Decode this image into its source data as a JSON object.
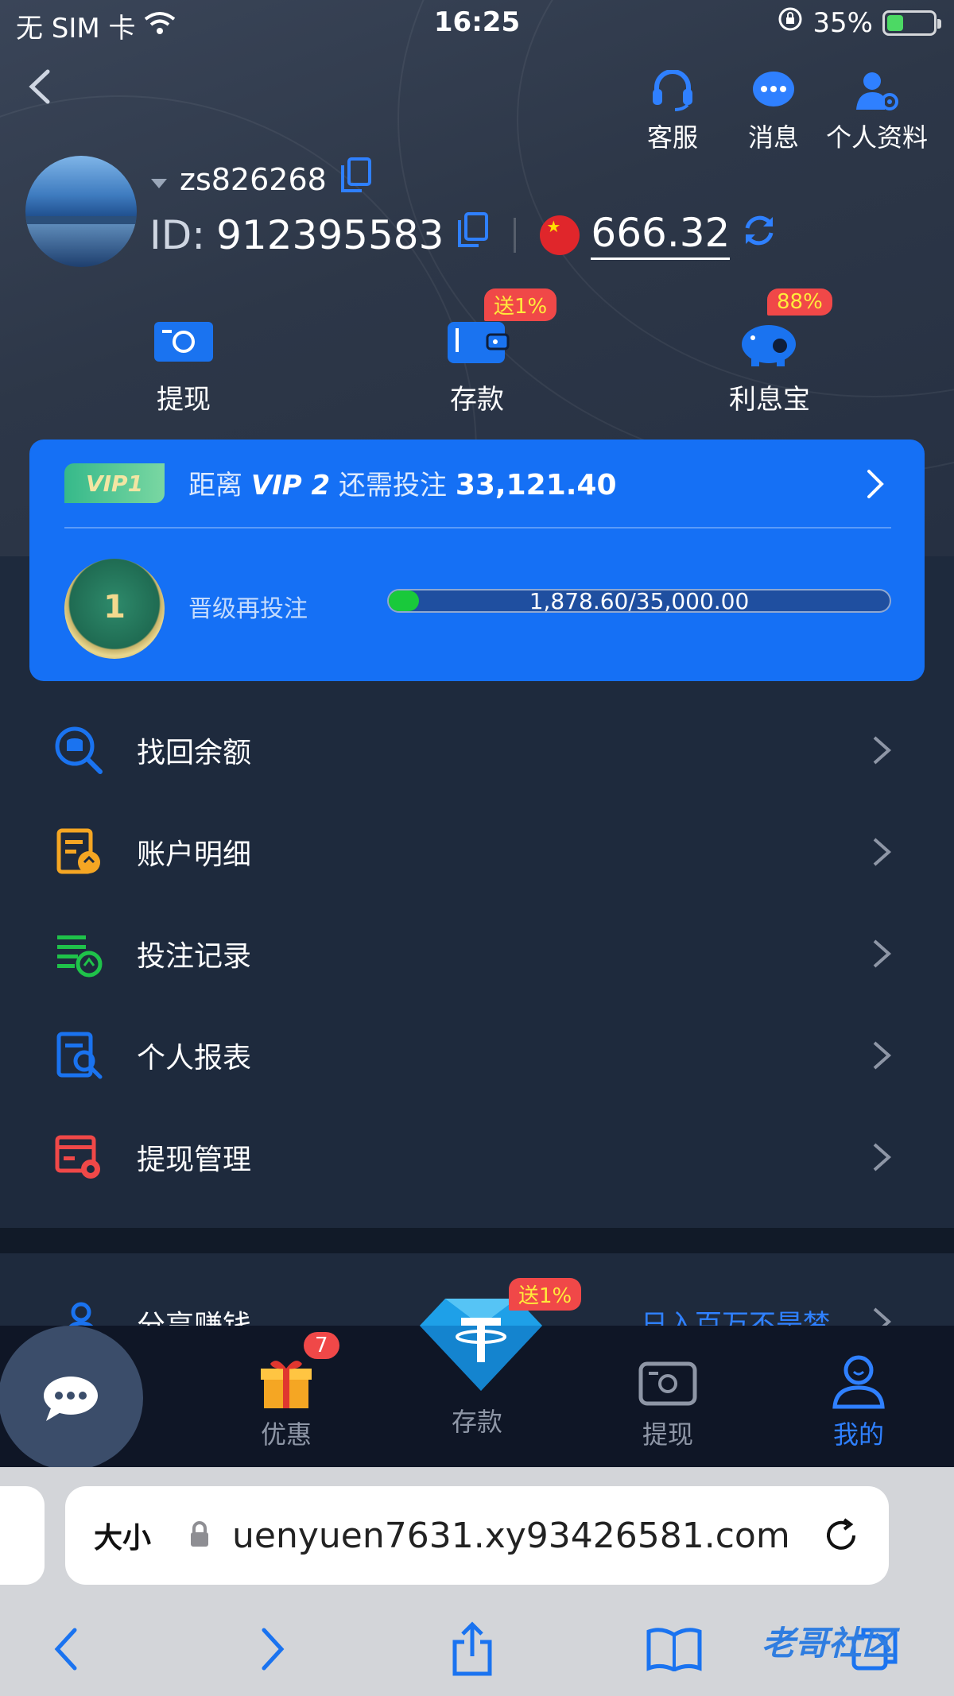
{
  "status_bar": {
    "carrier": "无 SIM 卡",
    "time": "16:25",
    "battery": "35%"
  },
  "top_actions": [
    {
      "label": "客服"
    },
    {
      "label": "消息"
    },
    {
      "label": "个人资料"
    }
  ],
  "profile": {
    "username": "zs826268",
    "id_label": "ID:",
    "id_value": "912395583",
    "balance": "666.32"
  },
  "quick_actions": [
    {
      "label": "提现",
      "badge": ""
    },
    {
      "label": "存款",
      "badge": "送1%"
    },
    {
      "label": "利息宝",
      "badge": "88%"
    }
  ],
  "vip": {
    "level_tag": "VIP1",
    "distance_prefix": "距离",
    "next_level": "VIP 2",
    "need_bet_text": "还需投注",
    "need_bet_amount": "33,121.40",
    "medal_number": "1",
    "progress_label": "晋级再投注",
    "progress_text": "1,878.60/35,000.00",
    "progress_fraction": 0.0537
  },
  "menu": [
    {
      "label": "找回余额",
      "icon": "search-database-icon"
    },
    {
      "label": "账户明细",
      "icon": "account-details-icon"
    },
    {
      "label": "投注记录",
      "icon": "bet-records-icon"
    },
    {
      "label": "个人报表",
      "icon": "personal-report-icon"
    },
    {
      "label": "提现管理",
      "icon": "withdraw-settings-icon"
    }
  ],
  "share_row": {
    "label": "分享赚钱",
    "hint": "日入百万不是梦"
  },
  "bottom_nav": {
    "items": [
      {
        "label": "优惠",
        "badge": "7"
      },
      {
        "label": "存款",
        "badge": "送1%"
      },
      {
        "label": "提现",
        "badge": ""
      },
      {
        "label": "我的",
        "badge": ""
      }
    ]
  },
  "browser": {
    "text_size_label": "大小",
    "url": "uenyuen7631.xy93426581.com"
  },
  "watermark": "老哥社区",
  "colors": {
    "accent_blue": "#1570f5",
    "badge_red": "#f04848",
    "progress_green": "#19c93b",
    "background": "#1e2a3d"
  }
}
